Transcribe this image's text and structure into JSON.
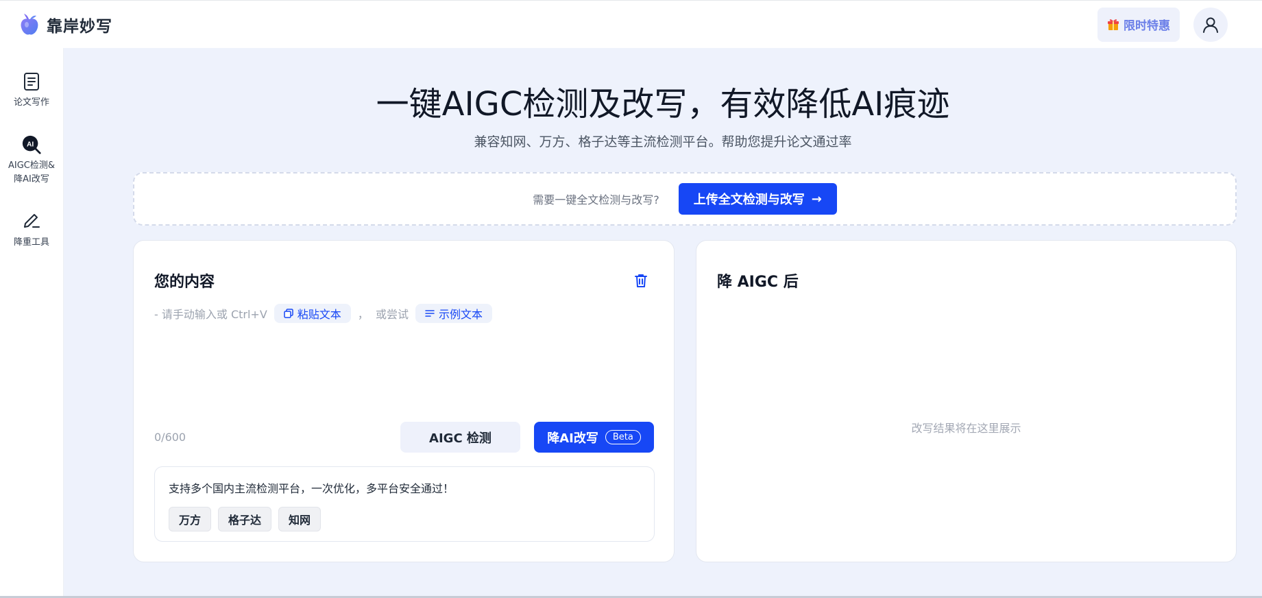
{
  "header": {
    "brand_name": "靠岸妙写",
    "promo_label": "限时特惠"
  },
  "sidebar": {
    "items": [
      {
        "label": "论文写作"
      },
      {
        "label": "AIGC检测&\n降AI改写"
      },
      {
        "label": "降重工具"
      }
    ]
  },
  "hero": {
    "title": "一键AIGC检测及改写，有效降低AI痕迹",
    "subtitle": "兼容知网、万方、格子达等主流检测平台。帮助您提升论文通过率"
  },
  "upload": {
    "hint": "需要一键全文检测与改写?",
    "button_label": "上传全文检测与改写",
    "button_arrow": "→"
  },
  "input_card": {
    "title": "您的内容",
    "hint_prefix": "- 请手动输入或 Ctrl+V",
    "paste_label": "粘贴文本",
    "or_try": "，  或尝试",
    "example_label": "示例文本",
    "counter": "0/600",
    "detect_label": "AIGC 检测",
    "rewrite_label": "降AI改写",
    "beta_label": "Beta",
    "platform_text": "支持多个国内主流检测平台，一次优化，多平台安全通过！",
    "platforms": [
      "万方",
      "格子达",
      "知网"
    ]
  },
  "result_card": {
    "title": "降 AIGC 后",
    "empty_text": "改写结果将在这里展示"
  },
  "colors": {
    "accent": "#1747f5",
    "page_bg": "#eef2fc",
    "promo_text": "#6b7fe8"
  }
}
